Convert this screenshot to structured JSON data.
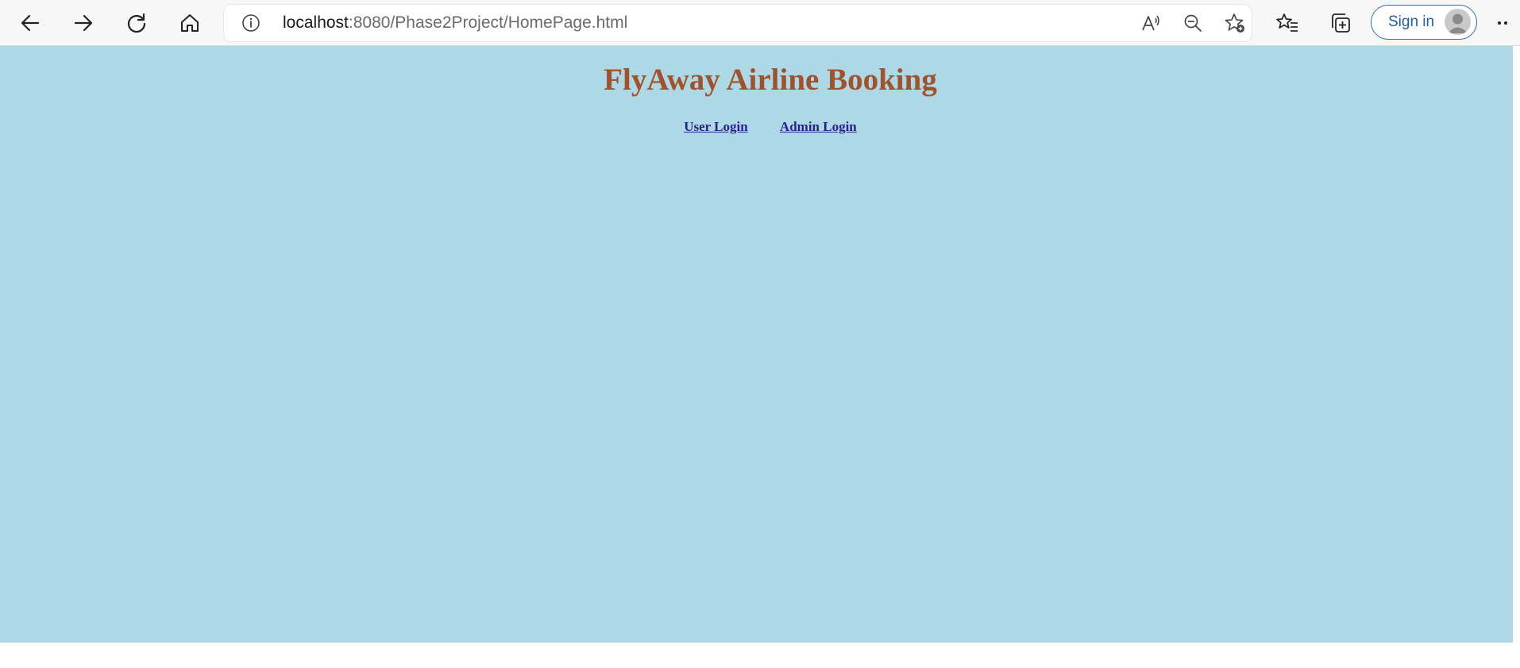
{
  "browser": {
    "nav": {
      "back_icon": "arrow-left-icon",
      "forward_icon": "arrow-right-icon",
      "refresh_icon": "refresh-icon",
      "home_icon": "home-icon"
    },
    "address_bar": {
      "info_icon": "info-icon",
      "host": "localhost",
      "path": ":8080/Phase2Project/HomePage.html",
      "read_aloud_icon": "read-aloud-icon",
      "zoom_out_icon": "zoom-out-icon",
      "add_favorite_icon": "star-add-icon"
    },
    "toolbar": {
      "favorites_icon": "favorites-icon",
      "collections_icon": "collections-icon",
      "sign_in_label": "Sign in",
      "avatar_icon": "avatar-icon",
      "more_label": "··"
    }
  },
  "page": {
    "background": "#add8e6",
    "title": "FlyAway Airline Booking",
    "title_color": "#a0522d",
    "links": {
      "user_login": "User Login",
      "admin_login": "Admin Login"
    },
    "link_color": "#2b1f8f"
  }
}
